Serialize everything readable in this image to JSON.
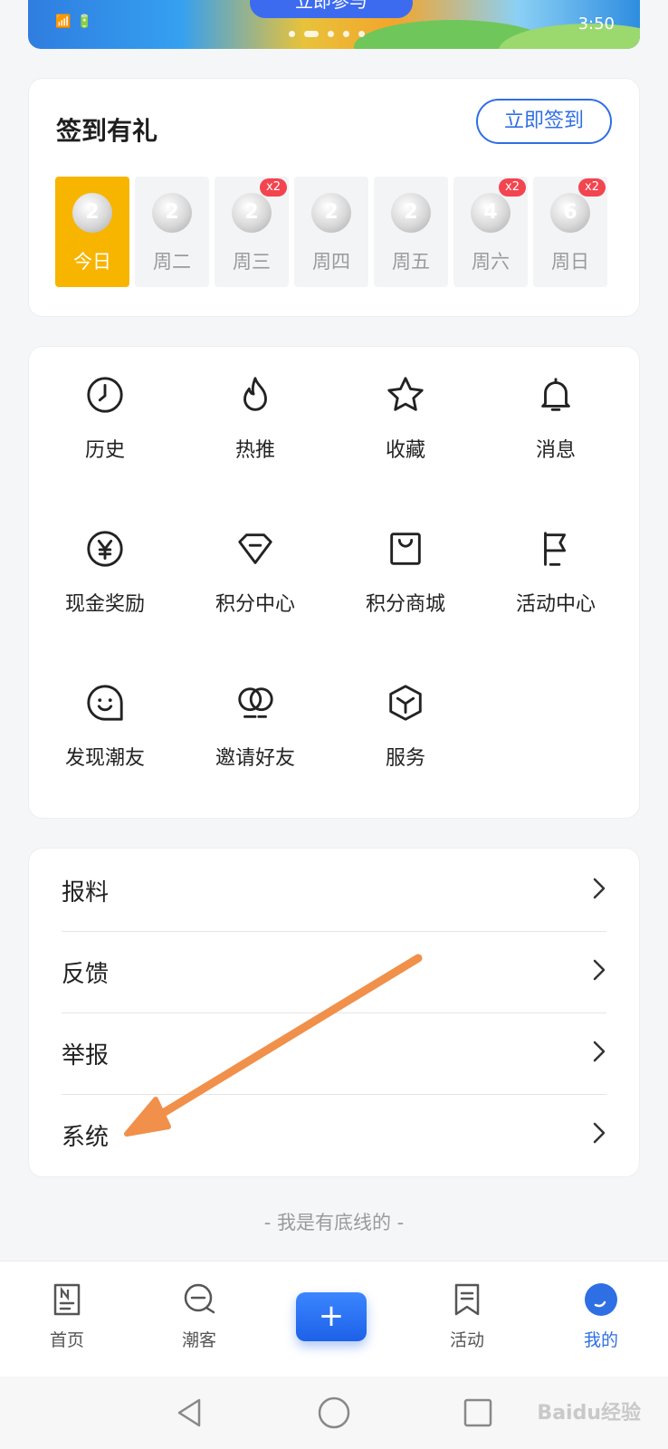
{
  "banner": {
    "button_label": "立即参与",
    "status_left": [
      "📶",
      "🔋"
    ],
    "time": "3:50"
  },
  "signin": {
    "title": "签到有礼",
    "button_label": "立即签到",
    "days": [
      {
        "label": "今日",
        "coin": "2",
        "badge": ""
      },
      {
        "label": "周二",
        "coin": "2",
        "badge": ""
      },
      {
        "label": "周三",
        "coin": "2",
        "badge": "x2"
      },
      {
        "label": "周四",
        "coin": "2",
        "badge": ""
      },
      {
        "label": "周五",
        "coin": "2",
        "badge": ""
      },
      {
        "label": "周六",
        "coin": "4",
        "badge": "x2"
      },
      {
        "label": "周日",
        "coin": "6",
        "badge": "x2"
      }
    ]
  },
  "grid": {
    "items": [
      {
        "label": "历史",
        "icon": "clock-icon"
      },
      {
        "label": "热推",
        "icon": "flame-icon"
      },
      {
        "label": "收藏",
        "icon": "star-icon"
      },
      {
        "label": "消息",
        "icon": "bell-icon"
      },
      {
        "label": "现金奖励",
        "icon": "yen-icon"
      },
      {
        "label": "积分中心",
        "icon": "diamond-icon"
      },
      {
        "label": "积分商城",
        "icon": "shopping-bag-icon"
      },
      {
        "label": "活动中心",
        "icon": "flag-icon"
      },
      {
        "label": "发现潮友",
        "icon": "smiley-bubble-icon"
      },
      {
        "label": "邀请好友",
        "icon": "friends-icon"
      },
      {
        "label": "服务",
        "icon": "cube-icon"
      }
    ]
  },
  "list": {
    "items": [
      "报料",
      "反馈",
      "举报",
      "系统"
    ]
  },
  "footer_note": "- 我是有底线的 -",
  "tabbar": {
    "tabs": [
      {
        "label": "首页",
        "icon": "home-doc-icon"
      },
      {
        "label": "潮客",
        "icon": "chat-icon"
      },
      {
        "label": "活动",
        "icon": "bookmark-icon"
      },
      {
        "label": "我的",
        "icon": "profile-icon"
      }
    ],
    "plus": "+",
    "active_color": "#2f6fe4"
  },
  "watermark": "Baidu经验",
  "colors": {
    "accent": "#2f6fe4",
    "today": "#f7b500",
    "badge": "#f2454f",
    "annotation_arrow": "#f0904a"
  }
}
